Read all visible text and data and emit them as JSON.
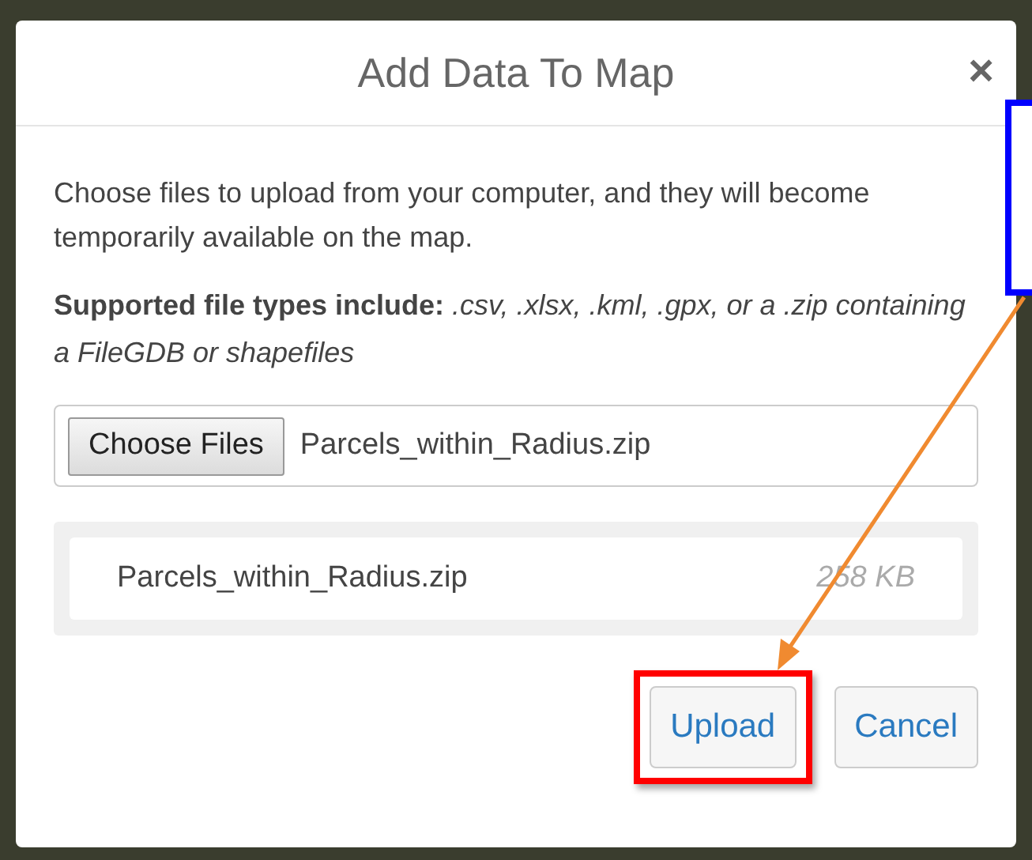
{
  "dialog": {
    "title": "Add Data To Map",
    "close": "×",
    "description": "Choose files to upload from your computer, and they will become temporarily available on the map.",
    "supported": "**Supported file types include:** *.csv, .xlsx, .kml, .gpx, or a .zip containing a FileGDB or shapefiles*",
    "file_input": {
      "button": "Choose Files",
      "value": "Parcels_within_Radius.zip"
    },
    "files": [
      {
        "name": "Parcels_within_Radius.zip",
        "size": "258 KB"
      }
    ],
    "buttons": [
      {
        "label": "Upload",
        "highlighted": true
      },
      {
        "label": "Cancel",
        "highlighted": false
      }
    ]
  }
}
